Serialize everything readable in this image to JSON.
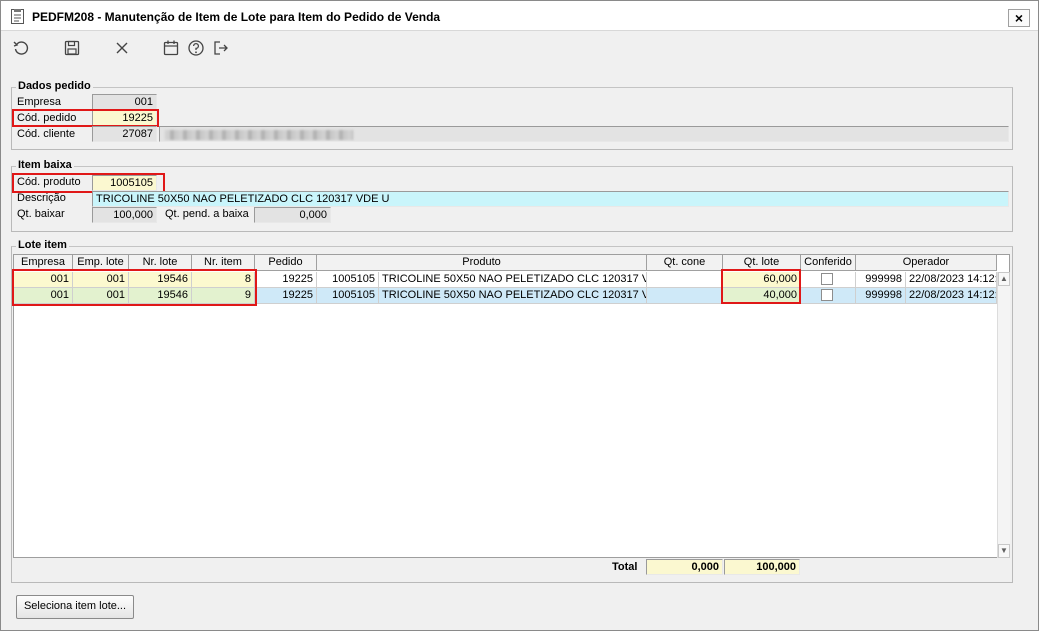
{
  "window": {
    "title": "PEDFM208 - Manutenção de Item de Lote para Item do Pedido de Venda",
    "close_label": "×"
  },
  "toolbar": {
    "icons": [
      "refresh-icon",
      "save-icon",
      "cancel-icon",
      "calendar-icon",
      "help-icon",
      "exit-icon"
    ]
  },
  "dados_pedido": {
    "legend": "Dados pedido",
    "empresa_label": "Empresa",
    "empresa_value": "001",
    "cod_pedido_label": "Cód. pedido",
    "cod_pedido_value": "19225",
    "cod_cliente_label": "Cód. cliente",
    "cod_cliente_value": "27087"
  },
  "item_baixa": {
    "legend": "Item baixa",
    "cod_produto_label": "Cód. produto",
    "cod_produto_value": "1005105",
    "descricao_label": "Descrição",
    "descricao_value": "TRICOLINE 50X50 NAO PELETIZADO CLC 120317 VDE U",
    "qt_baixar_label": "Qt. baixar",
    "qt_baixar_value": "100,000",
    "qt_pend_label": "Qt. pend. a baixa",
    "qt_pend_value": "0,000"
  },
  "lote_item": {
    "legend": "Lote item",
    "columns": [
      "Empresa",
      "Emp. lote",
      "Nr. lote",
      "Nr. item",
      "Pedido",
      "Produto",
      "Qt. cone",
      "Qt. lote",
      "Conferido",
      "Operador"
    ],
    "rows": [
      {
        "empresa": "001",
        "emp_lote": "001",
        "nr_lote": "19546",
        "nr_item": "8",
        "pedido": "19225",
        "produto_cod": "1005105",
        "produto_desc": "TRICOLINE 50X50 NAO PELETIZADO CLC 120317 VDE",
        "qt_cone": "",
        "qt_lote": "60,000",
        "conferido": false,
        "operador_cod": "999998",
        "operador_data": "22/08/2023 14:12:"
      },
      {
        "empresa": "001",
        "emp_lote": "001",
        "nr_lote": "19546",
        "nr_item": "9",
        "pedido": "19225",
        "produto_cod": "1005105",
        "produto_desc": "TRICOLINE 50X50 NAO PELETIZADO CLC 120317 VDE",
        "qt_cone": "",
        "qt_lote": "40,000",
        "conferido": false,
        "operador_cod": "999998",
        "operador_data": "22/08/2023 14:12:"
      }
    ]
  },
  "totals": {
    "label": "Total",
    "qt_cone": "0,000",
    "qt_lote": "100,000"
  },
  "actions": {
    "seleciona_label": "Seleciona item lote..."
  },
  "colors": {
    "highlight_red": "#e01818",
    "cyan_field": "#c9f5fb",
    "yellow_field": "#fbf8d0",
    "row_selected": "#cfe9f8",
    "row_yellow": "#fcf9cf"
  }
}
